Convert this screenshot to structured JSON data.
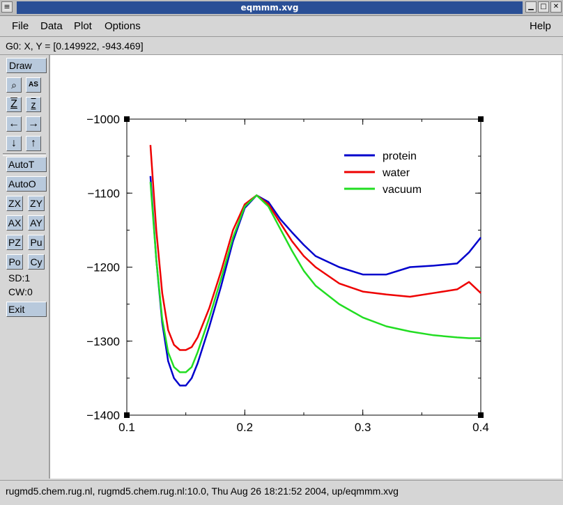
{
  "window": {
    "title": "eqmmm.xvg",
    "menu_glyph": "≡",
    "min_glyph": "▁",
    "max_glyph": "□",
    "close_glyph": "✕"
  },
  "menu": {
    "file": "File",
    "data": "Data",
    "plot": "Plot",
    "options": "Options",
    "help": "Help"
  },
  "coord_readout": "G0: X, Y = [0.149922, -943.469]",
  "sidebar": {
    "draw": "Draw",
    "autot": "AutoT",
    "autoo": "AutoO",
    "zx": "ZX",
    "zy": "ZY",
    "ax": "AX",
    "ay": "AY",
    "pz": "PZ",
    "pu": "Pu",
    "po": "Po",
    "cy": "Cy",
    "sd": "SD:1",
    "cw": "CW:0",
    "exit": "Exit",
    "icon_glyphs": {
      "zoom": "⌕",
      "autoscale": "AS",
      "zoom_in": "Z",
      "zoom_out": "z",
      "left": "←",
      "right": "→",
      "down": "↓",
      "up": "↑"
    }
  },
  "status": "rugmd5.chem.rug.nl, rugmd5.chem.rug.nl:10.0, Thu Aug 26 18:21:52 2004, up/eqmmm.xvg",
  "chart_data": {
    "type": "line",
    "xlim": [
      0.1,
      0.4
    ],
    "ylim": [
      -1400,
      -1000
    ],
    "xticks": [
      0.1,
      0.2,
      0.3,
      0.4
    ],
    "yticks": [
      -1400,
      -1300,
      -1200,
      -1100,
      -1000
    ],
    "xtick_labels": [
      "0.1",
      "0.2",
      "0.3",
      "0.4"
    ],
    "ytick_labels": [
      "−1400",
      "−1300",
      "−1200",
      "−1100",
      "−1000"
    ],
    "legend_position": "top-right",
    "series": [
      {
        "name": "protein",
        "color": "#0000cc",
        "x": [
          0.12,
          0.125,
          0.13,
          0.135,
          0.14,
          0.145,
          0.15,
          0.155,
          0.16,
          0.17,
          0.18,
          0.19,
          0.2,
          0.21,
          0.22,
          0.23,
          0.24,
          0.25,
          0.26,
          0.28,
          0.3,
          0.32,
          0.34,
          0.36,
          0.38,
          0.39,
          0.4
        ],
        "y": [
          -1077,
          -1190,
          -1275,
          -1327,
          -1350,
          -1360,
          -1360,
          -1350,
          -1330,
          -1280,
          -1225,
          -1165,
          -1120,
          -1103,
          -1112,
          -1135,
          -1153,
          -1170,
          -1185,
          -1200,
          -1210,
          -1210,
          -1200,
          -1198,
          -1195,
          -1180,
          -1160
        ]
      },
      {
        "name": "water",
        "color": "#ee0000",
        "x": [
          0.12,
          0.125,
          0.13,
          0.135,
          0.14,
          0.145,
          0.15,
          0.155,
          0.16,
          0.17,
          0.18,
          0.19,
          0.2,
          0.21,
          0.22,
          0.23,
          0.24,
          0.25,
          0.26,
          0.28,
          0.3,
          0.32,
          0.34,
          0.36,
          0.38,
          0.39,
          0.4
        ],
        "y": [
          -1035,
          -1150,
          -1235,
          -1285,
          -1305,
          -1312,
          -1312,
          -1308,
          -1295,
          -1255,
          -1205,
          -1150,
          -1115,
          -1103,
          -1115,
          -1140,
          -1165,
          -1185,
          -1200,
          -1222,
          -1233,
          -1237,
          -1240,
          -1235,
          -1230,
          -1220,
          -1235
        ]
      },
      {
        "name": "vacuum",
        "color": "#22dd22",
        "x": [
          0.12,
          0.125,
          0.13,
          0.135,
          0.14,
          0.145,
          0.15,
          0.155,
          0.16,
          0.17,
          0.18,
          0.19,
          0.2,
          0.21,
          0.22,
          0.23,
          0.24,
          0.25,
          0.26,
          0.28,
          0.3,
          0.32,
          0.34,
          0.36,
          0.38,
          0.39,
          0.4
        ],
        "y": [
          -1085,
          -1190,
          -1270,
          -1315,
          -1335,
          -1342,
          -1342,
          -1335,
          -1315,
          -1268,
          -1215,
          -1160,
          -1118,
          -1103,
          -1118,
          -1148,
          -1178,
          -1205,
          -1225,
          -1250,
          -1268,
          -1280,
          -1287,
          -1292,
          -1295,
          -1296,
          -1296
        ]
      }
    ]
  }
}
